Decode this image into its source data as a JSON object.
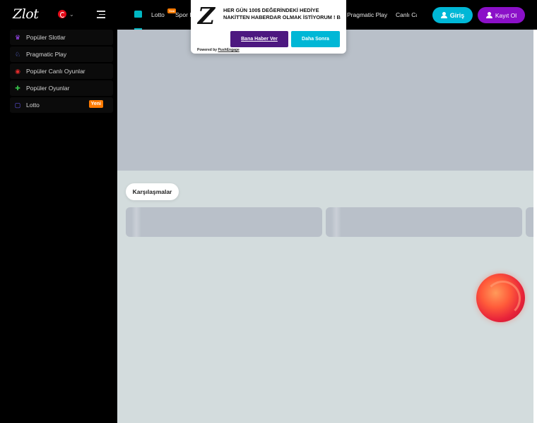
{
  "header": {
    "logo_text": "Zlot",
    "language_flag": "turkey-flag",
    "nav": {
      "lotto": "Lotto",
      "lotto_badge": "Yeni",
      "spor": "Spor B",
      "pragmatic": "Pragmatic Play",
      "canli": "Canlı Ca"
    },
    "login_label": "Giriş",
    "register_label": "Kayıt Ol"
  },
  "popup": {
    "logo": "Z",
    "message": "HER GÜN 100$ DEĞERİNDEKİ HEDİYE NAKİTTEN HABERDAR OLMAK İSTİYORUM ! B",
    "accept_label": "Bana Haber Ver",
    "decline_label": "Daha Sonra",
    "powered_by": "Powered by",
    "powered_brand": "PushEngage"
  },
  "sidebar": {
    "items": [
      {
        "label": "Popüler Slotlar",
        "icon": "slots-icon",
        "color": "#a44bff"
      },
      {
        "label": "Pragmatic Play",
        "icon": "pragmatic-icon",
        "color": "#6b7cff"
      },
      {
        "label": "Popüler Canlı Oyunlar",
        "icon": "live-casino-icon",
        "color": "#e22c2c"
      },
      {
        "label": "Popüler Oyunlar",
        "icon": "games-icon",
        "color": "#37c24a"
      },
      {
        "label": "Lotto",
        "icon": "lotto-icon",
        "color": "#6b5cff",
        "badge": "Yeni"
      }
    ]
  },
  "main": {
    "matches_tab": "Karşılaşmalar"
  },
  "colors": {
    "accent_cyan": "#00b7d6",
    "accent_purple": "#8b10c8",
    "badge_orange": "#ff7a00"
  }
}
